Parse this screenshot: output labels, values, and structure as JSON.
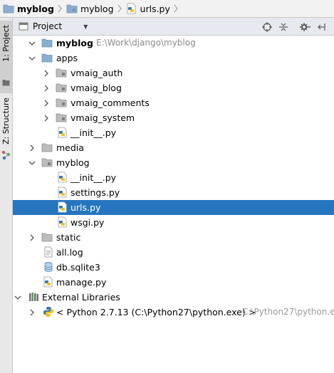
{
  "breadcrumbs": [
    {
      "label": "myblog",
      "icon": "folder-icon",
      "bold": true
    },
    {
      "label": "myblog",
      "icon": "folder-icon",
      "bold": false
    },
    {
      "label": "urls.py",
      "icon": "python-file-icon",
      "bold": false
    }
  ],
  "side_tabs": {
    "project": "1: Project",
    "structure": "Z: Structure"
  },
  "panel": {
    "title": "Project",
    "view_dropdown": "▼"
  },
  "tree": {
    "root": {
      "name": "myblog",
      "path": "E:\\Work\\django\\myblog"
    },
    "items": [
      {
        "name": "apps",
        "kind": "folder-open"
      },
      {
        "name": "vmaig_auth",
        "kind": "package-closed"
      },
      {
        "name": "vmaig_blog",
        "kind": "package-closed"
      },
      {
        "name": "vmaig_comments",
        "kind": "package-closed"
      },
      {
        "name": "vmaig_system",
        "kind": "package-closed"
      },
      {
        "name": "__init__.py",
        "kind": "python-file"
      },
      {
        "name": "media",
        "kind": "folder-closed"
      },
      {
        "name": "myblog",
        "kind": "package-open"
      },
      {
        "name": "__init__.py",
        "kind": "python-file"
      },
      {
        "name": "settings.py",
        "kind": "python-file"
      },
      {
        "name": "urls.py",
        "kind": "python-file",
        "selected": true
      },
      {
        "name": "wsgi.py",
        "kind": "python-file"
      },
      {
        "name": "static",
        "kind": "folder-closed"
      },
      {
        "name": "all.log",
        "kind": "text-file"
      },
      {
        "name": "db.sqlite3",
        "kind": "database-file"
      },
      {
        "name": "manage.py",
        "kind": "python-file"
      },
      {
        "name": "External Libraries",
        "kind": "libraries"
      },
      {
        "name": "< Python 2.7.13 (C:\\Python27\\python.exe) >",
        "kind": "python-sdk",
        "path": "C:\\Python27\\python.exe"
      }
    ]
  },
  "colors": {
    "selection": "#2675bf",
    "folder": "#8aaecf",
    "header_bg": "#e6e9ef"
  }
}
